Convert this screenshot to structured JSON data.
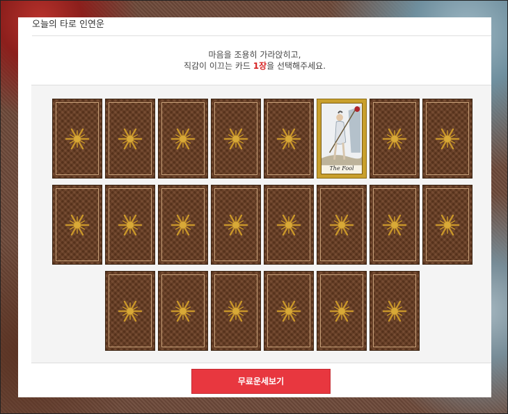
{
  "panel": {
    "title": "오늘의 타로 인연운",
    "instruction_line1": "마음을 조용히 가라앉히고,",
    "instruction_prefix": "직감이 이끄는 카드 ",
    "instruction_count": "1장",
    "instruction_suffix": "을 선택해주세요."
  },
  "cards": {
    "back_icon": "sun-motif-icon",
    "rows": [
      {
        "count": 8,
        "revealed_index": 5
      },
      {
        "count": 8,
        "revealed_index": -1
      },
      {
        "count": 6,
        "revealed_index": -1
      }
    ],
    "revealed_card": {
      "name": "The Fool"
    }
  },
  "cta": {
    "label": "무료운세보기"
  },
  "colors": {
    "accent": "#e8373f",
    "highlight": "#d62323",
    "card_back": "#6b3e22",
    "card_frame_gold": "#c9a02d"
  }
}
